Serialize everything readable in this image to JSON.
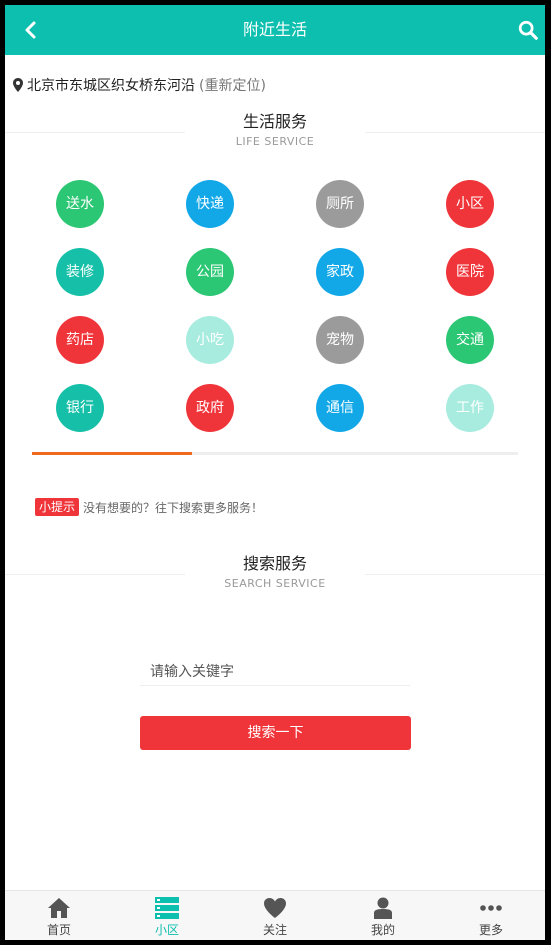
{
  "header": {
    "title": "附近生活"
  },
  "location": {
    "address": "北京市东城区织女桥东河沿",
    "relocate": "(重新定位)"
  },
  "life_section": {
    "title": "生活服务",
    "subtitle": "LIFE SERVICE"
  },
  "services": [
    [
      {
        "label": "送水",
        "color": "#2cc774"
      },
      {
        "label": "快递",
        "color": "#12a8e8"
      },
      {
        "label": "厕所",
        "color": "#9b9b9b"
      },
      {
        "label": "小区",
        "color": "#f0353a"
      }
    ],
    [
      {
        "label": "装修",
        "color": "#16c0a8"
      },
      {
        "label": "公园",
        "color": "#2cc774"
      },
      {
        "label": "家政",
        "color": "#12a8e8"
      },
      {
        "label": "医院",
        "color": "#f0353a"
      }
    ],
    [
      {
        "label": "药店",
        "color": "#f0353a"
      },
      {
        "label": "小吃",
        "color": "#a7ecdf"
      },
      {
        "label": "宠物",
        "color": "#9b9b9b"
      },
      {
        "label": "交通",
        "color": "#2cc774"
      }
    ],
    [
      {
        "label": "银行",
        "color": "#16c0a8"
      },
      {
        "label": "政府",
        "color": "#f0353a"
      },
      {
        "label": "通信",
        "color": "#12a8e8"
      },
      {
        "label": "工作",
        "color": "#a7ecdf"
      }
    ]
  ],
  "services_progress": 0.33,
  "tip": {
    "badge": "小提示",
    "text": "没有想要的？往下搜索更多服务！"
  },
  "search_section": {
    "title": "搜索服务",
    "subtitle": "SEARCH SERVICE"
  },
  "search": {
    "placeholder": "请输入关键字",
    "button": "搜索一下"
  },
  "tabs": [
    {
      "label": "首页",
      "icon": "home-icon"
    },
    {
      "label": "小区",
      "icon": "community-icon",
      "active": true
    },
    {
      "label": "关注",
      "icon": "heart-icon"
    },
    {
      "label": "我的",
      "icon": "user-icon"
    },
    {
      "label": "更多",
      "icon": "more-icon"
    }
  ],
  "colors": {
    "primary": "#0dbfae",
    "accent_red": "#f0353a",
    "progress": "#f06a1e"
  }
}
